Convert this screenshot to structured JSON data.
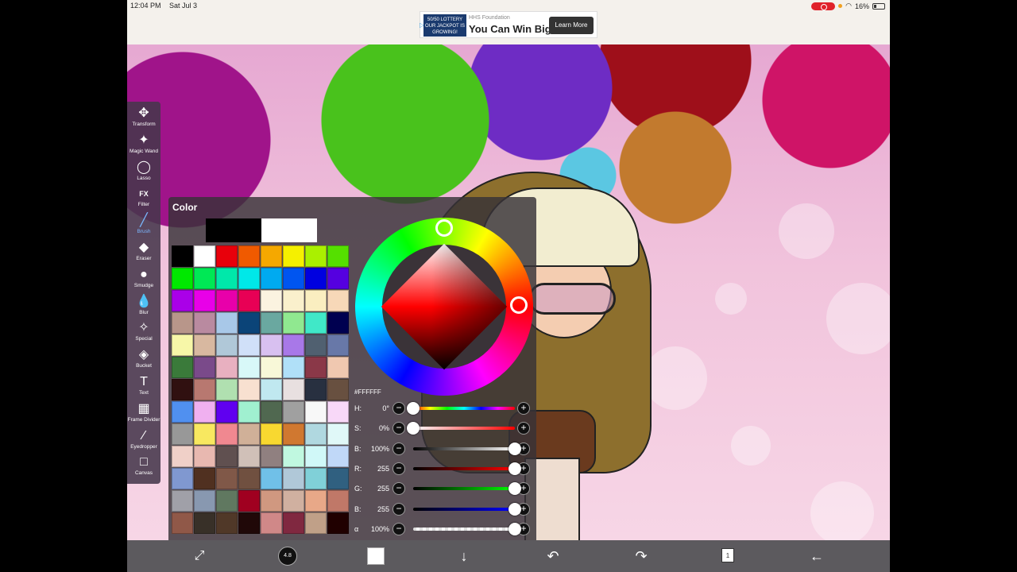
{
  "status": {
    "time": "12:04 PM",
    "date": "Sat Jul 3",
    "battery": "16%"
  },
  "ad": {
    "sponsor": "HHS Foundation",
    "headline": "You Can Win Big",
    "cta": "Learn More",
    "logo_text": "50/50 LOTTERY OUR JACKPOT IS GROWING!"
  },
  "toolbar": {
    "items": [
      {
        "label": "Transform",
        "icon": "move-icon",
        "glyph": "✥"
      },
      {
        "label": "Magic Wand",
        "icon": "magic-wand-icon",
        "glyph": "✦"
      },
      {
        "label": "Lasso",
        "icon": "lasso-icon",
        "glyph": "◯"
      },
      {
        "label": "Filter",
        "icon": "fx-icon",
        "glyph": "FX"
      },
      {
        "label": "Brush",
        "icon": "brush-icon",
        "glyph": "╱"
      },
      {
        "label": "Eraser",
        "icon": "eraser-icon",
        "glyph": "◆"
      },
      {
        "label": "Smudge",
        "icon": "smudge-icon",
        "glyph": "●"
      },
      {
        "label": "Blur",
        "icon": "blur-icon",
        "glyph": "💧"
      },
      {
        "label": "Special",
        "icon": "special-icon",
        "glyph": "✧"
      },
      {
        "label": "Bucket",
        "icon": "bucket-icon",
        "glyph": "◈"
      },
      {
        "label": "Text",
        "icon": "text-icon",
        "glyph": "T"
      },
      {
        "label": "Frame Divider",
        "icon": "frame-divider-icon",
        "glyph": "▦"
      },
      {
        "label": "Eyedropper",
        "icon": "eyedropper-icon",
        "glyph": "⁄"
      },
      {
        "label": "Canvas",
        "icon": "canvas-icon",
        "glyph": "□"
      }
    ],
    "active": "Brush"
  },
  "color_panel": {
    "title": "Color",
    "previous_color": "#000000",
    "current_color": "#FFFFFF",
    "hex": "#FFFFFF",
    "swatches": [
      "#000000",
      "#ffffff",
      "#e8000b",
      "#f05a00",
      "#f5a800",
      "#f5f000",
      "#aaf000",
      "#55e000",
      "#00e800",
      "#00e855",
      "#00e8aa",
      "#00e8e8",
      "#00aaf0",
      "#0055f0",
      "#0000e0",
      "#5500e0",
      "#aa00e8",
      "#e800e8",
      "#e800aa",
      "#e80055",
      "#fbf3e0",
      "#faf0cc",
      "#faeec0",
      "#f7d8b8",
      "#b8968a",
      "#b98aa0",
      "#a8c8e8",
      "#0b4478",
      "#6aa8a0",
      "#90e890",
      "#40e8c8",
      "#000050",
      "#f7f7a8",
      "#d8b8a0",
      "#b0c8d8",
      "#d0e0f8",
      "#d8c0f0",
      "#a878e8",
      "#506070",
      "#6878a8",
      "#3a7a3a",
      "#7a4a8a",
      "#e8b0c0",
      "#d8f8f8",
      "#f8f8d8",
      "#b0e0f8",
      "#8a3848",
      "#f0c8b0",
      "#301010",
      "#b87870",
      "#b0e0b0",
      "#f8e0d0",
      "#c0e8f0",
      "#e8e0e0",
      "#283040",
      "#685040",
      "#5090f0",
      "#f0b0f0",
      "#6000f0",
      "#a0f0d0",
      "#506850",
      "#a0a0a0",
      "#f8f8f8",
      "#f8d8f8",
      "#989898",
      "#f8e860",
      "#f08890",
      "#d0b098",
      "#f8d830",
      "#d07830",
      "#b0d8e0",
      "#e0f8f8",
      "#f0d0c8",
      "#e8b8b0",
      "#605050",
      "#d0c0b8",
      "#908080",
      "#c0f8e0",
      "#d0f8f8",
      "#c0d8f8",
      "#8098d0",
      "#503020",
      "#805848",
      "#705040",
      "#70c0e8",
      "#b0c8d8",
      "#80d0d8",
      "#306080",
      "#a0a0a8",
      "#8898b0",
      "#607860",
      "#a00020",
      "#d09880",
      "#d0b0a0",
      "#e8a888",
      "#c07868",
      "#905848",
      "#383028",
      "#503828",
      "#200808",
      "#d08888",
      "#802840",
      "#c0a088",
      "#200000"
    ],
    "sliders": [
      {
        "label": "H:",
        "value": "0°",
        "name": "hue"
      },
      {
        "label": "S:",
        "value": "0%",
        "name": "saturation"
      },
      {
        "label": "B:",
        "value": "100%",
        "name": "brightness"
      },
      {
        "label": "R:",
        "value": "255",
        "name": "red"
      },
      {
        "label": "G:",
        "value": "255",
        "name": "green"
      },
      {
        "label": "B:",
        "value": "255",
        "name": "blue"
      },
      {
        "label": "α",
        "value": "100%",
        "name": "alpha"
      }
    ],
    "slider_levels": [
      0,
      0,
      1,
      1,
      1,
      1,
      1
    ]
  },
  "bottom_bar": {
    "brush_size": "4.8",
    "layer_count": "1"
  }
}
